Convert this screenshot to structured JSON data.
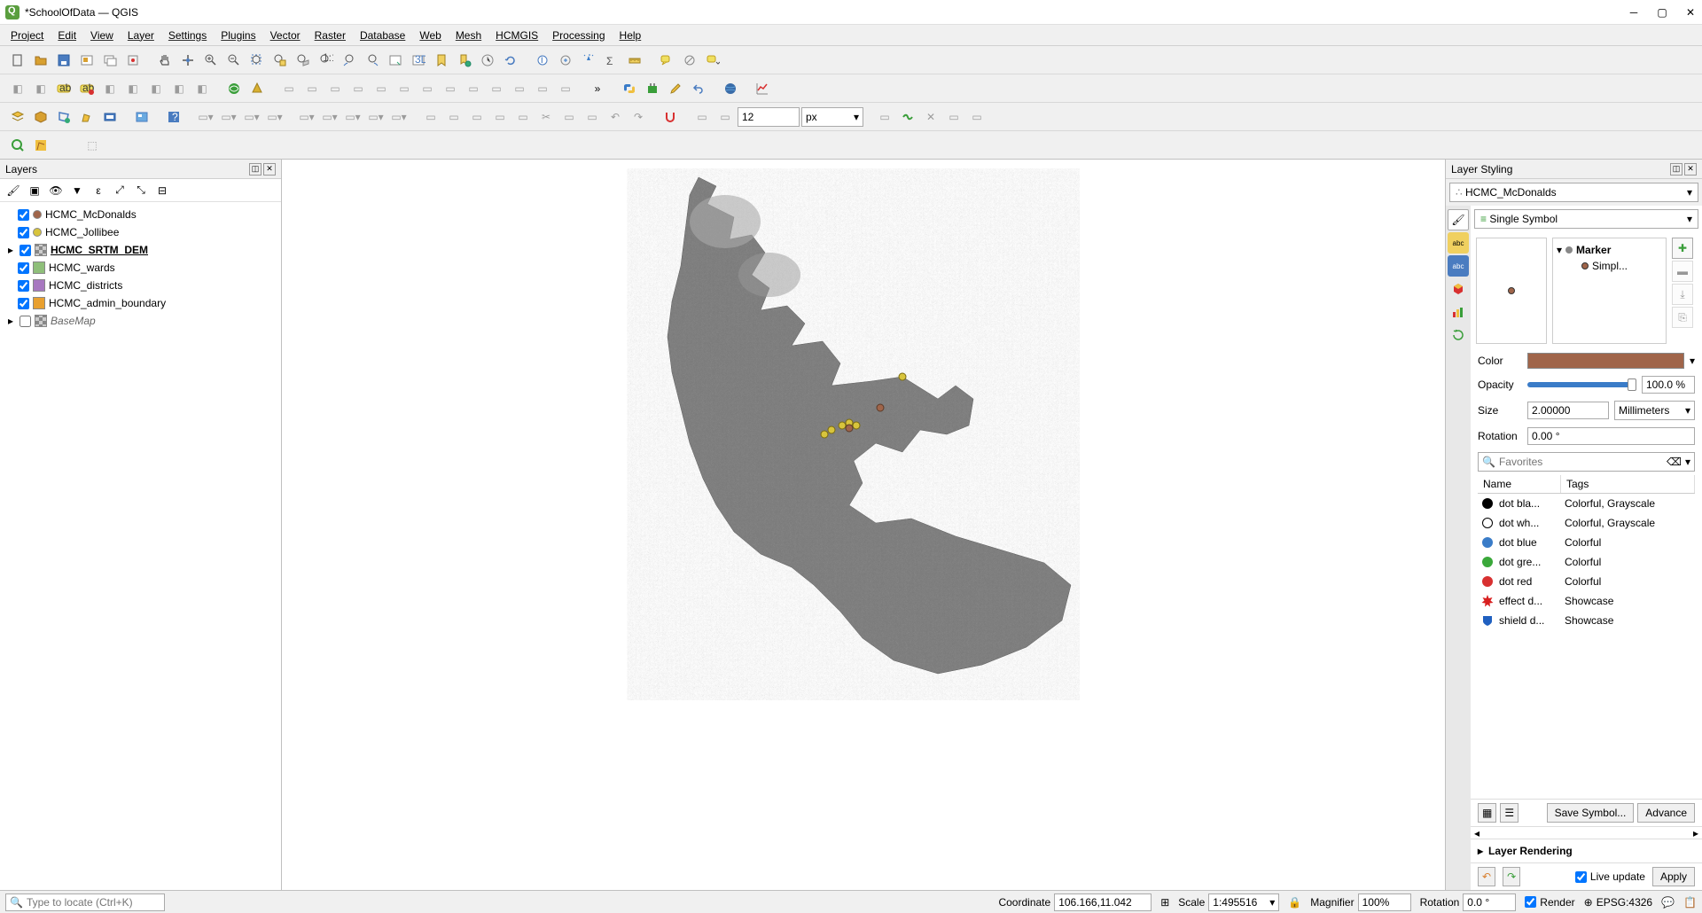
{
  "window": {
    "title": "*SchoolOfData — QGIS"
  },
  "menu": [
    "Project",
    "Edit",
    "View",
    "Layer",
    "Settings",
    "Plugins",
    "Vector",
    "Raster",
    "Database",
    "Web",
    "Mesh",
    "HCMGIS",
    "Processing",
    "Help"
  ],
  "toolbar4": {
    "size_value": "12",
    "size_unit": "px"
  },
  "layers_panel": {
    "title": "Layers",
    "items": [
      {
        "checked": true,
        "swatch": "#a0654a",
        "shape": "circle",
        "name": "HCMC_McDonalds",
        "bold": false
      },
      {
        "checked": true,
        "swatch": "#d8c43c",
        "shape": "circle",
        "name": "HCMC_Jollibee",
        "bold": false
      },
      {
        "checked": true,
        "swatch": "checker",
        "shape": "square",
        "name": "HCMC_SRTM_DEM",
        "bold": true,
        "expandable": true
      },
      {
        "checked": true,
        "swatch": "#8fbf7a",
        "shape": "square",
        "name": "HCMC_wards",
        "bold": false
      },
      {
        "checked": true,
        "swatch": "#a878c0",
        "shape": "square",
        "name": "HCMC_districts",
        "bold": false
      },
      {
        "checked": true,
        "swatch": "#e8a030",
        "shape": "square",
        "name": "HCMC_admin_boundary",
        "bold": false
      },
      {
        "checked": false,
        "swatch": "checker",
        "shape": "square",
        "name": "BaseMap",
        "italic": true,
        "expandable": true
      }
    ]
  },
  "styling": {
    "title": "Layer Styling",
    "layer_selected": "HCMC_McDonalds",
    "symbol_type": "Single Symbol",
    "tree": {
      "root": "Marker",
      "child": "Simpl..."
    },
    "color": "#a0654a",
    "opacity": "100.0 %",
    "size_value": "2.00000",
    "size_unit": "Millimeters",
    "rotation": "0.00 °",
    "fav_placeholder": "Favorites",
    "fav_cols": [
      "Name",
      "Tags"
    ],
    "favs": [
      {
        "color": "#000000",
        "stroke": "",
        "name": "dot bla...",
        "tags": "Colorful, Grayscale"
      },
      {
        "color": "#ffffff",
        "stroke": "#000",
        "name": "dot wh...",
        "tags": "Colorful, Grayscale"
      },
      {
        "color": "#3a7cc8",
        "stroke": "",
        "name": "dot blue",
        "tags": "Colorful"
      },
      {
        "color": "#3aa83a",
        "stroke": "",
        "name": "dot gre...",
        "tags": "Colorful"
      },
      {
        "color": "#d83030",
        "stroke": "",
        "name": "dot red",
        "tags": "Colorful"
      },
      {
        "color": "#d82020",
        "stroke": "",
        "name": "effect d...",
        "tags": "Showcase",
        "shape": "star"
      },
      {
        "color": "#2060c0",
        "stroke": "",
        "name": "shield d...",
        "tags": "Showcase",
        "shape": "shield"
      }
    ],
    "save_btn": "Save Symbol...",
    "advance_btn": "Advance",
    "render_section": "Layer Rendering",
    "live_update": "Live update",
    "apply_btn": "Apply",
    "labels": {
      "color": "Color",
      "opacity": "Opacity",
      "size": "Size",
      "rotation": "Rotation"
    }
  },
  "status": {
    "locator_placeholder": "Type to locate (Ctrl+K)",
    "coord_label": "Coordinate",
    "coord_value": "106.166,11.042",
    "scale_label": "Scale",
    "scale_value": "1:495516",
    "magnifier_label": "Magnifier",
    "magnifier_value": "100%",
    "rotation_label": "Rotation",
    "rotation_value": "0.0 °",
    "render_label": "Render",
    "crs_label": "EPSG:4326"
  }
}
